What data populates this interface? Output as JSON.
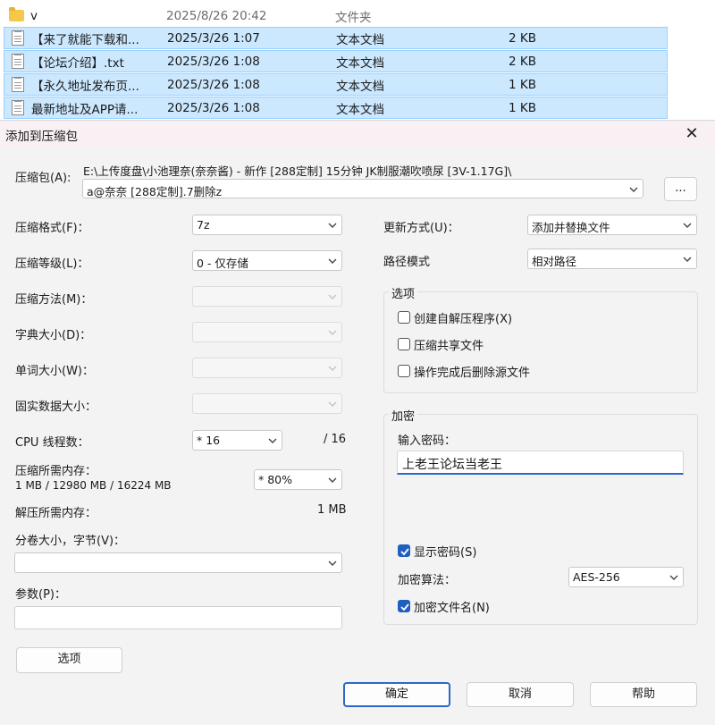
{
  "files": [
    {
      "name": "v",
      "date": "2025/8/26 20:42",
      "type": "文件夹",
      "size": "",
      "icon": "folder-icon"
    },
    {
      "name": "【来了就能下载和...",
      "date": "2025/3/26 1:07",
      "type": "文本文档",
      "size": "2 KB",
      "icon": "text-file-icon"
    },
    {
      "name": "【论坛介绍】.txt",
      "date": "2025/3/26 1:08",
      "type": "文本文档",
      "size": "2 KB",
      "icon": "text-file-icon"
    },
    {
      "name": "【永久地址发布页...",
      "date": "2025/3/26 1:08",
      "type": "文本文档",
      "size": "1 KB",
      "icon": "text-file-icon"
    },
    {
      "name": "最新地址及APP请...",
      "date": "2025/3/26 1:08",
      "type": "文本文档",
      "size": "1 KB",
      "icon": "text-file-icon"
    }
  ],
  "dialog": {
    "title": "添加到压缩包",
    "close_glyph": "✕",
    "archive_label": "压缩包(A):",
    "archive_path": "E:\\上传度盘\\小池理奈(奈奈酱) - 新作 [288定制] 15分钟 JK制服潮吹喷尿 [3V-1.17G]\\",
    "archive_name": "a@奈奈 [288定制].7删除z",
    "browse_label": "...",
    "format_label": "压缩格式(F)：",
    "format_value": "7z",
    "level_label": "压缩等级(L)：",
    "level_value": "0 - 仅存储",
    "method_label": "压缩方法(M)：",
    "dict_label": "字典大小(D)：",
    "word_label": "单词大小(W)：",
    "solid_label": "固实数据大小：",
    "cpu_label": "CPU 线程数：",
    "cpu_value": "* 16",
    "cpu_total": "/ 16",
    "mem_comp_label": "压缩所需内存：",
    "mem_comp_detail": "1 MB / 12980 MB / 16224 MB",
    "mem_percent": "* 80%",
    "mem_decomp_label": "解压所需内存：",
    "mem_decomp_value": "1 MB",
    "volume_label": "分卷大小，字节(V)：",
    "volume_value": "",
    "params_label": "参数(P)：",
    "params_value": "",
    "options_button": "选项",
    "update_label": "更新方式(U)：",
    "update_value": "添加并替换文件",
    "path_label": "路径模式",
    "path_value": "相对路径",
    "options_group": "选项",
    "opt_sfx": "创建自解压程序(X)",
    "opt_shared": "压缩共享文件",
    "opt_delete": "操作完成后删除源文件",
    "encrypt_group": "加密",
    "password_label": "输入密码：",
    "password_value": "上老王论坛当老王",
    "show_password": "显示密码(S)",
    "algo_label": "加密算法：",
    "algo_value": "AES-256",
    "encrypt_names": "加密文件名(N)",
    "ok": "确定",
    "cancel": "取消",
    "help": "帮助"
  }
}
